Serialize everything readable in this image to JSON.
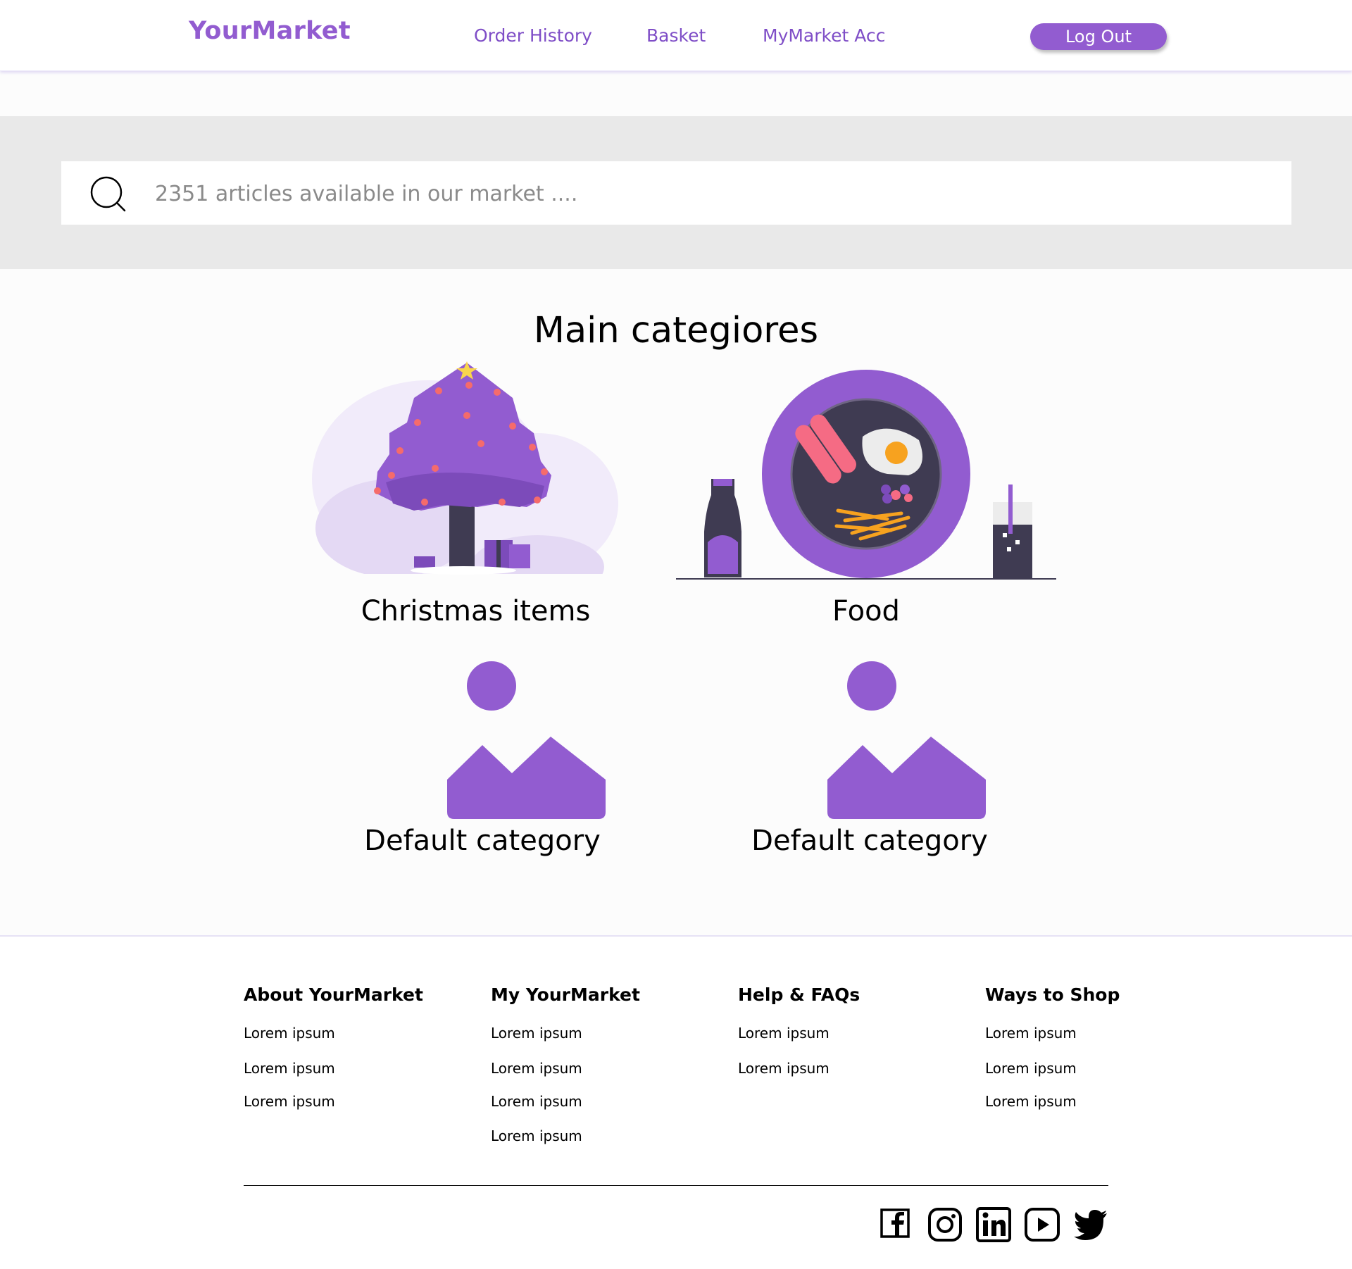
{
  "header": {
    "logo": "YourMarket",
    "nav": [
      "Order History",
      "Basket",
      "MyMarket Acc"
    ],
    "logout_label": "Log Out"
  },
  "search": {
    "placeholder": "2351 articles available in our market ...."
  },
  "main": {
    "title": "Main categiores",
    "categories": [
      {
        "label": "Christmas items",
        "image": "christmas-tree-illustration"
      },
      {
        "label": "Food",
        "image": "food-plate-illustration"
      },
      {
        "label": "Default category",
        "image": "image-placeholder-icon"
      },
      {
        "label": "Default category",
        "image": "image-placeholder-icon"
      }
    ]
  },
  "footer": {
    "columns": [
      {
        "heading": "About YourMarket",
        "links": [
          "Lorem ipsum",
          "Lorem ipsum",
          "Lorem ipsum"
        ]
      },
      {
        "heading": "My YourMarket",
        "links": [
          "Lorem ipsum",
          "Lorem ipsum",
          "Lorem ipsum",
          "Lorem ipsum"
        ]
      },
      {
        "heading": "Help & FAQs",
        "links": [
          "Lorem ipsum",
          "Lorem ipsum"
        ]
      },
      {
        "heading": "Ways to Shop",
        "links": [
          "Lorem ipsum",
          "Lorem ipsum",
          "Lorem ipsum"
        ]
      }
    ],
    "social": [
      "facebook-icon",
      "instagram-icon",
      "linkedin-icon",
      "youtube-icon",
      "twitter-icon"
    ]
  },
  "colors": {
    "accent": "#925cd0",
    "nav_text": "#7f4ec7",
    "search_band": "#e9e9e9",
    "page_bg": "#fcfcfc"
  }
}
